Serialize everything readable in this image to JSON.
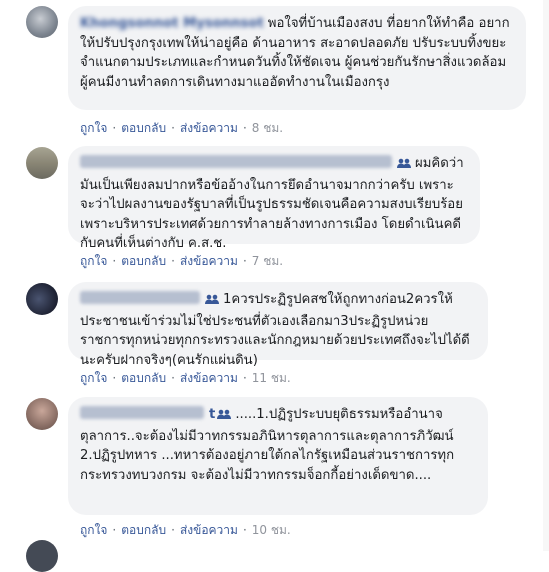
{
  "comments": [
    {
      "name": "Khongsonnot Mysonnsot",
      "text": "พอใจที่บ้านเมืองสงบ ที่อยากให้ทำคือ อยากให้ปรับปรุงกรุงเทพให้น่าอยู่คือ ด้านอาหาร สะอาดปลอดภัย ปรับระบบทิ้งขยะจำแนกตามประเภทและกำหนดวันทิ้งให้ชัดเจน ผู้คนช่วยกันรักษาสิ่งแวดล้อม ผู้คนมีงานทำลดการเดินทางมาแออัดทำงานในเมืองกรุง",
      "like": "ถูกใจ",
      "reply": "ตอบกลับ",
      "message": "ส่งข้อความ",
      "time": "8 ชม."
    },
    {
      "name": "",
      "text": "ผมคิดว่ามันเป็นเพียงลมปากหรือข้ออ้างในการยึดอำนาจมากกว่าครับ เพราะจะว่าไปผลงานของรัฐบาลที่เป็นรูปธรรมชัดเจนคือความสงบเรียบร้อย เพราะบริหารประเทศด้วยการทำลายล้างทางการเมือง โดยดำเนินคดีกับคนที่เห็นต่างกับ ค.ส.ช.",
      "like": "ถูกใจ",
      "reply": "ตอบกลับ",
      "message": "ส่งข้อความ",
      "time": "7 ชม."
    },
    {
      "name": "",
      "text": "1ควรประฏิรูปคสชให้ถูกทางก่อน2ควรให้ประชาชนเข้าร่วมไม่ใช่ประชนที่ตัวเองเลือกมา3ประฏิรูปหน่วยราชการทุกหน่วยทุกกระทรวงและนักกฎหมายด้วยประเทศถึงจะไปได้ดีนะครับฝากจริงๆ(คนรักแผ่นดิน)",
      "like": "ถูกใจ",
      "reply": "ตอบกลับ",
      "message": "ส่งข้อความ",
      "time": "11 ชม."
    },
    {
      "name": "t",
      "text": ".....1.ปฏิรูประบบยุติธรรมหรืออำนาจตุลาการ..จะต้องไม่มีวาทกรรมอภินิหารตุลาการและตุลาการภิวัฒน์",
      "text2": "2.ปฏิรูปทหาร ...ทหารต้องอยู่ภายใต้กลไกรัฐเหมือนส่วนราชการทุกกระทรวงทบวงกรม จะต้องไม่มีวาทกรรมจ็อกกี้อย่างเด็ดขาด....",
      "like": "ถูกใจ",
      "reply": "ตอบกลับ",
      "message": "ส่งข้อความ",
      "time": "10 ชม."
    }
  ],
  "colors": {
    "link": "#385898",
    "bubble": "#f2f3f5",
    "text": "#1c1e21",
    "meta": "#606770",
    "time": "#90949c"
  }
}
